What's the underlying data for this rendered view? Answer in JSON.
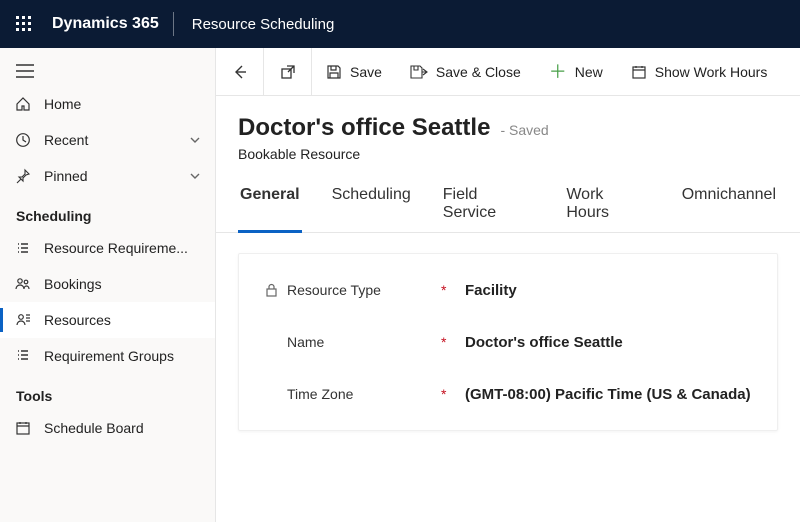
{
  "topbar": {
    "brand": "Dynamics 365",
    "app": "Resource Scheduling"
  },
  "sidebar": {
    "home": "Home",
    "recent": "Recent",
    "pinned": "Pinned",
    "section_scheduling": "Scheduling",
    "resource_requirements": "Resource Requireme...",
    "bookings": "Bookings",
    "resources": "Resources",
    "requirement_groups": "Requirement Groups",
    "section_tools": "Tools",
    "schedule_board": "Schedule Board"
  },
  "commands": {
    "save": "Save",
    "save_close": "Save & Close",
    "new": "New",
    "show_work_hours": "Show Work Hours"
  },
  "record": {
    "title": "Doctor's office Seattle",
    "status": "- Saved",
    "entity": "Bookable Resource"
  },
  "tabs": {
    "general": "General",
    "scheduling": "Scheduling",
    "field_service": "Field Service",
    "work_hours": "Work Hours",
    "omnichannel": "Omnichannel"
  },
  "fields": {
    "resource_type_label": "Resource Type",
    "resource_type_value": "Facility",
    "name_label": "Name",
    "name_value": "Doctor's office Seattle",
    "timezone_label": "Time Zone",
    "timezone_value": "(GMT-08:00) Pacific Time (US & Canada)"
  }
}
